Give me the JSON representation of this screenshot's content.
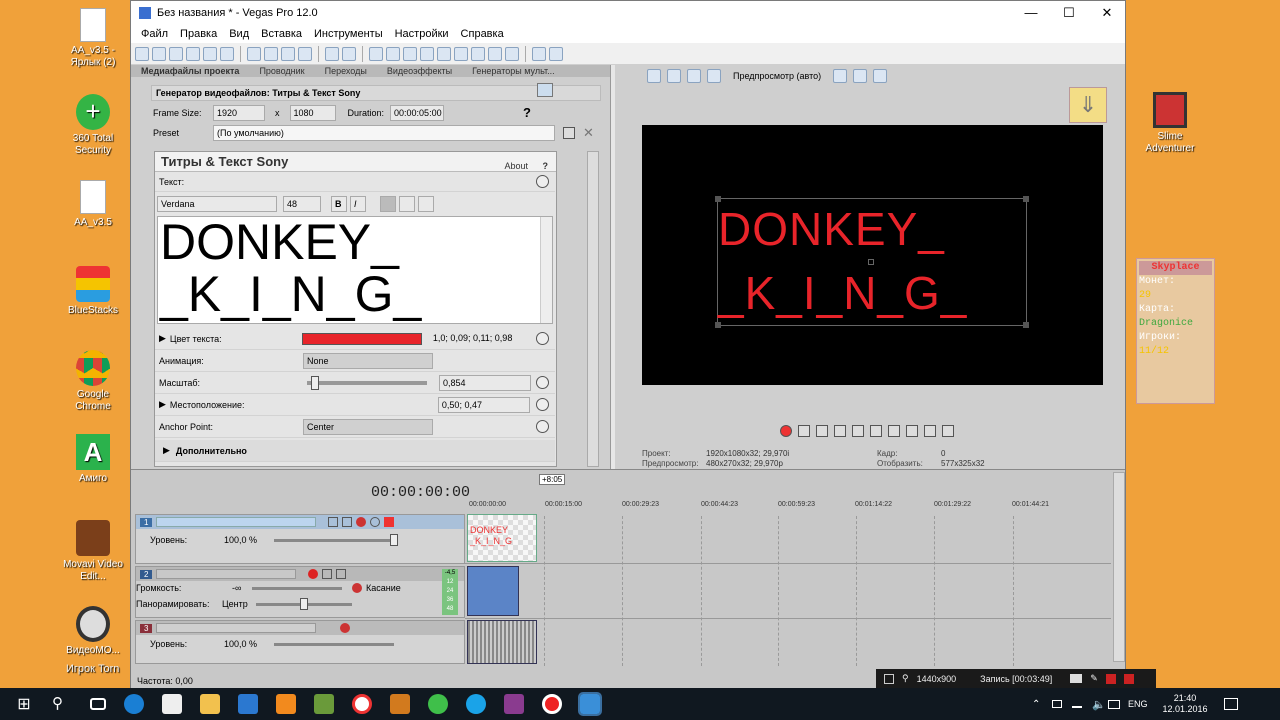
{
  "desktop": {
    "icons": [
      {
        "label": "АА_v3.5 - Ярлык (2)",
        "icon": "document-icon"
      },
      {
        "label": "360 Total Security",
        "icon": "security-plus-icon"
      },
      {
        "label": "АА_v3.5",
        "icon": "document-icon"
      },
      {
        "label": "BlueStacks",
        "icon": "bluestacks-icon"
      },
      {
        "label": "Google Chrome",
        "icon": "chrome-icon"
      },
      {
        "label": "Амиго",
        "icon": "amigo-icon"
      },
      {
        "label": "Movavi Video Edit...",
        "icon": "movavi-icon"
      },
      {
        "label": "ВидеоМО...",
        "icon": "film-reel-icon"
      }
    ],
    "overlay_text": "Игрок Torn",
    "right_icon": {
      "label": "Slime Adventurer"
    },
    "scoreboard": {
      "title": "Skyplace",
      "coins_label": "Монет:",
      "coins_value": "29",
      "map_label": "Карта:",
      "map_value": "Dragonice",
      "players_label": "Игроки:",
      "players_value": "11/12"
    }
  },
  "window": {
    "title": "Без названия * - Vegas Pro 12.0",
    "menu": [
      "Файл",
      "Правка",
      "Вид",
      "Вставка",
      "Инструменты",
      "Настройки",
      "Справка"
    ]
  },
  "left": {
    "tabs": [
      "Медиафайлы проекта",
      "Проводник",
      "Переходы",
      "Видеоэффекты",
      "Генераторы мульт..."
    ],
    "generator_title": "Генератор видеофайлов: Титры & Текст Sony",
    "frame_size_label": "Frame Size:",
    "frame_w": "1920",
    "x_label": "x",
    "frame_h": "1080",
    "duration_label": "Duration:",
    "duration": "00:00:05:00",
    "preset_label": "Preset",
    "preset_value": "(По умолчанию)",
    "plugin_title": "Титры & Текст Sony",
    "about": "About",
    "help": "?",
    "text_label": "Текст:",
    "font": "Verdana",
    "size": "48",
    "bold": "B",
    "italic": "I",
    "text_line1": "DONKEY_",
    "text_line2": "_K_I_N_G_",
    "color_label": "Цвет текста:",
    "color_value": "1,0; 0,09; 0,11; 0,98",
    "anim_label": "Анимация:",
    "anim_value": "None",
    "scale_label": "Масштаб:",
    "scale_value": "0,854",
    "position_label": "Местоположение:",
    "position_value": "0,50; 0,47",
    "anchor_label": "Anchor Point:",
    "anchor_value": "Center",
    "extra_label": "Дополнительно"
  },
  "preview": {
    "mode_label": "Предпросмотр (авто)",
    "line1": "DONKEY_",
    "line2": "_K_I_N_G_",
    "project_label": "Проект:",
    "project_value": "1920x1080x32; 29,970i",
    "preview_label": "Предпросмотр:",
    "preview_value": "480x270x32; 29,970p",
    "frame_label": "Кадр:",
    "frame_value": "0",
    "display_label": "Отобразить:",
    "display_value": "577x325x32"
  },
  "timeline": {
    "timecode": "00:00:00:00",
    "ruler_badge": "+8:05",
    "ruler": [
      "00:00:00:00",
      "00:00:15:00",
      "00:00:29:23",
      "00:00:44:23",
      "00:00:59:23",
      "00:01:14:22",
      "00:01:29:22",
      "00:01:44:21"
    ],
    "track1_num": "1",
    "track1_level_label": "Уровень:",
    "track1_level": "100,0 %",
    "track2_num": "2",
    "volume_label": "Громкость:",
    "volume_value": "-∞",
    "touch_label": "Касание",
    "pan_label": "Панорамировать:",
    "pan_value": "Центр",
    "meter_top": "-4,5",
    "meter_vals": [
      "12",
      "24",
      "36",
      "48"
    ],
    "track3_num": "3",
    "track3_level_label": "Уровень:",
    "track3_level": "100,0 %",
    "rate_label": "Частота: 0,00",
    "clip_text": "DONKEY _K_I_N_G"
  },
  "recorder": {
    "resolution": "1440x900",
    "recording": "Запись [00:03:49]"
  },
  "taskbar": {
    "lang": "ENG",
    "time": "21:40",
    "date": "12.01.2016"
  },
  "colors": {
    "text_red": "#e8242a",
    "desktop": "#f0a13a"
  }
}
